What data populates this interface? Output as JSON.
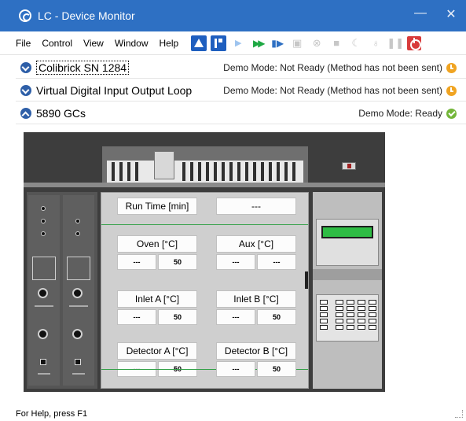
{
  "window": {
    "title": "LC - Device Monitor",
    "icon": "app-logo-icon",
    "minimize": "—",
    "close": "✕"
  },
  "menu": [
    "File",
    "Control",
    "View",
    "Window",
    "Help"
  ],
  "toolbar_icons": [
    "instrument-icon",
    "method-icon",
    "run-icon",
    "fast-forward-icon",
    "step-icon",
    "camera-icon",
    "abort-icon",
    "stop-icon",
    "sleep-icon",
    "lamp-icon",
    "pause-icon",
    "power-icon"
  ],
  "devices": [
    {
      "name": "Colibrick SN 1284",
      "status": "Demo Mode: Not Ready (Method has not been sent)",
      "state_icon": "clock-icon",
      "expanded": false
    },
    {
      "name": "Virtual Digital Input Output Loop",
      "status": "Demo Mode: Not Ready (Method has not been sent)",
      "state_icon": "clock-icon",
      "expanded": false
    },
    {
      "name": "5890 GCs",
      "status": "Demo Mode: Ready",
      "state_icon": "check-icon",
      "expanded": true
    }
  ],
  "gc_panel": {
    "run_time": {
      "label": "Run Time [min]",
      "value": "---"
    },
    "oven": {
      "label": "Oven [°C]",
      "actual": "---",
      "setpoint": "50"
    },
    "aux": {
      "label": "Aux [°C]",
      "actual": "---",
      "setpoint": "---"
    },
    "inlet_a": {
      "label": "Inlet A [°C]",
      "actual": "---",
      "setpoint": "50"
    },
    "inlet_b": {
      "label": "Inlet B [°C]",
      "actual": "---",
      "setpoint": "50"
    },
    "detector_a": {
      "label": "Detector A [°C]",
      "actual": "---",
      "setpoint": "50"
    },
    "detector_b": {
      "label": "Detector B [°C]",
      "actual": "---",
      "setpoint": "50"
    }
  },
  "status_bar": "For Help, press F1",
  "colors": {
    "title_bar": "#2e70c3",
    "ready": "#74b63a",
    "not_ready": "#f0a422",
    "display": "#2ebc44"
  }
}
